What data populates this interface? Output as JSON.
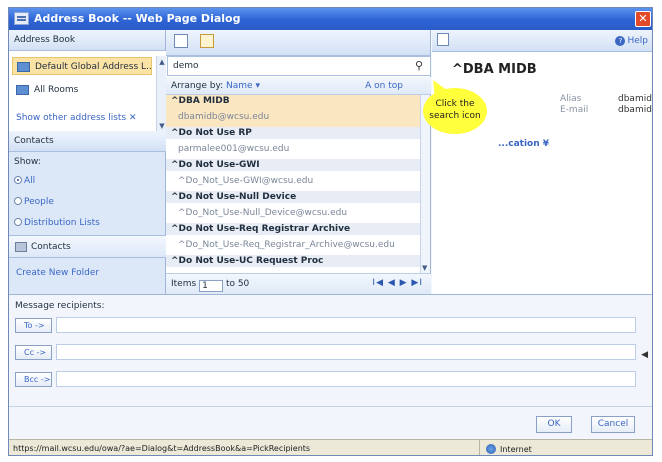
{
  "window": {
    "title": "Address Book -- Web Page Dialog",
    "close_glyph": "✕"
  },
  "left": {
    "header": "Address Book",
    "lists": [
      {
        "label": "Default Global Address L...",
        "selected": true
      },
      {
        "label": "All Rooms",
        "selected": false
      }
    ],
    "show_other": "Show other address lists ✕",
    "contacts_header": "Contacts",
    "show_label": "Show:",
    "filters": [
      "All",
      "People",
      "Distribution Lists"
    ],
    "selected_filter": "All",
    "contacts_button": "Contacts",
    "create_folder": "Create New Folder"
  },
  "middle": {
    "search_value": "demo",
    "search_icon": "magnifier",
    "arrange_prefix": "Arrange by:",
    "arrange_value": "Name ▾",
    "sort_label": "A on top",
    "results": [
      {
        "name": "^DBA MIDB",
        "email": "dbamidb@wcsu.edu",
        "selected": true
      },
      {
        "name": "^Do Not Use RP",
        "email": "parmalee001@wcsu.edu",
        "selected": false
      },
      {
        "name": "^Do Not Use-GWI",
        "email": "^Do_Not_Use-GWI@wcsu.edu",
        "selected": false
      },
      {
        "name": "^Do Not Use-Null Device",
        "email": "^Do_Not_Use-Null_Device@wcsu.edu",
        "selected": false
      },
      {
        "name": "^Do Not Use-Req Registrar Archive",
        "email": "^Do_Not_Use-Req_Registrar_Archive@wcsu.edu",
        "selected": false
      },
      {
        "name": "^Do Not Use-UC Request Proc",
        "email": "",
        "selected": false
      }
    ],
    "paging": {
      "items_label": "Items",
      "from": "1",
      "to_label": "to 50",
      "nav": "I◀ ◀ ▶ ▶I"
    }
  },
  "right": {
    "help_label": "Help",
    "contact_name": "^DBA MIDB",
    "fields": [
      {
        "label": "Alias",
        "value": "dbamidt"
      },
      {
        "label": "E-mail",
        "value": "dbamidt"
      }
    ],
    "additional": "...cation ¥"
  },
  "callout": {
    "text": "Click the search icon"
  },
  "recipients": {
    "title": "Message recipients:",
    "to": "To ->",
    "cc": "Cc ->",
    "bcc": "Bcc ->",
    "collapse": "◀"
  },
  "footer": {
    "ok": "OK",
    "cancel": "Cancel"
  },
  "status": {
    "url": "https://mail.wcsu.edu/owa/?ae=Dialog&t=AddressBook&a=PickRecipients",
    "zone": "Internet"
  }
}
